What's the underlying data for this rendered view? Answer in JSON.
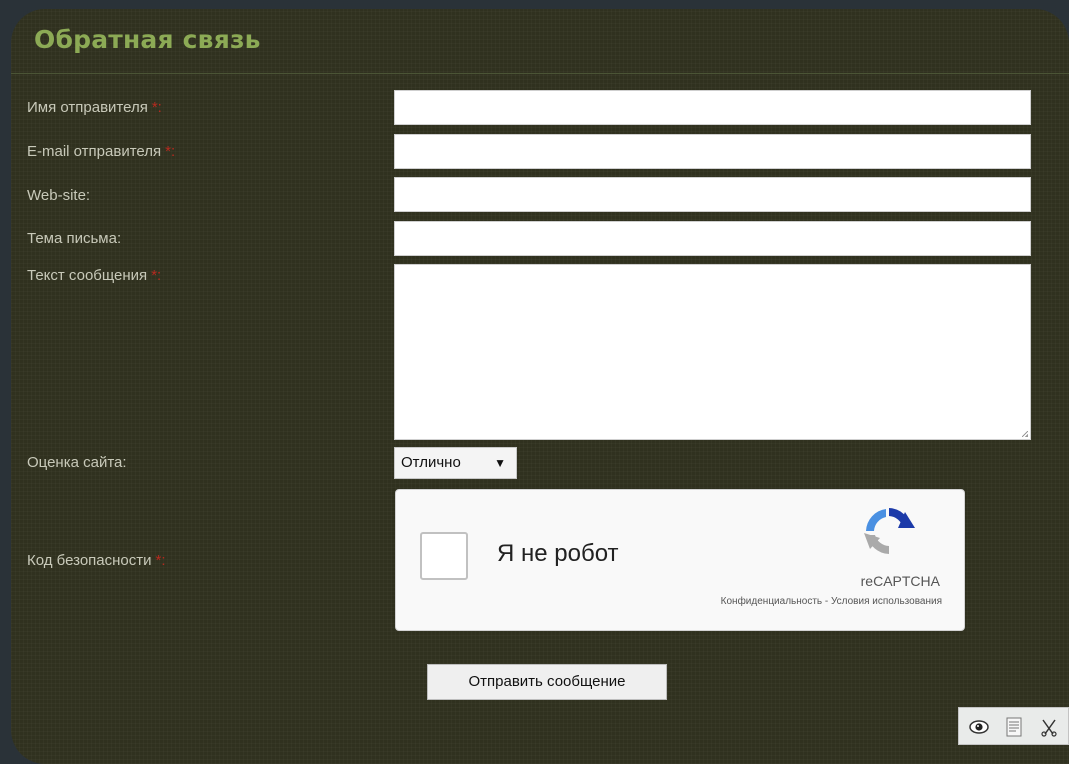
{
  "form": {
    "title": "Обратная связь",
    "required_mark": "*:",
    "fields": [
      {
        "label": "Имя отправителя",
        "required": true,
        "value": ""
      },
      {
        "label": "E-mail отправителя",
        "required": true,
        "value": ""
      },
      {
        "label": "Web-site:",
        "required": false,
        "value": ""
      },
      {
        "label": "Тема письма:",
        "required": false,
        "value": ""
      }
    ],
    "message": {
      "label": "Текст сообщения",
      "required": true,
      "value": ""
    },
    "rating": {
      "label": "Оценка сайта:",
      "selected": "Отлично",
      "arrow": "▼"
    },
    "security": {
      "label": "Код безопасности",
      "required": true
    },
    "submit_label": "Отправить сообщение"
  },
  "recaptcha": {
    "checkbox_label": "Я не робот",
    "brand": "reCAPTCHA",
    "links": "Конфиденциальность - Условия использования",
    "logo_icon": "recaptcha-logo-icon"
  },
  "toolbar": {
    "icons": [
      "eye-icon",
      "document-icon",
      "scissors-icon"
    ]
  },
  "colors": {
    "background": "#2a3238",
    "panel": "#30311f",
    "title": "#8caa55",
    "label": "#c8c9b9",
    "required": "#b62a1f"
  }
}
